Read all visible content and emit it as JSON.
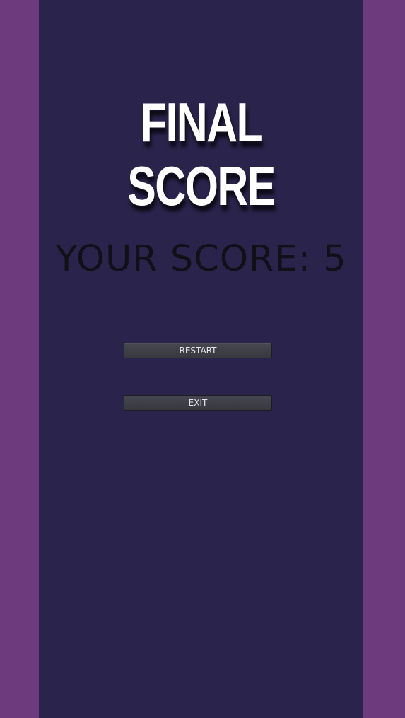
{
  "screen": {
    "title": "FINAL SCORE",
    "score_text": "YOUR SCORE: 5",
    "score_value": 5
  },
  "buttons": {
    "restart_label": "RESTART",
    "exit_label": "EXIT"
  },
  "colors": {
    "side_bars": "#6c3a7d",
    "background": "#2a244c",
    "title": "#ffffff",
    "score_text": "#111018",
    "button": "#3f3f46"
  }
}
